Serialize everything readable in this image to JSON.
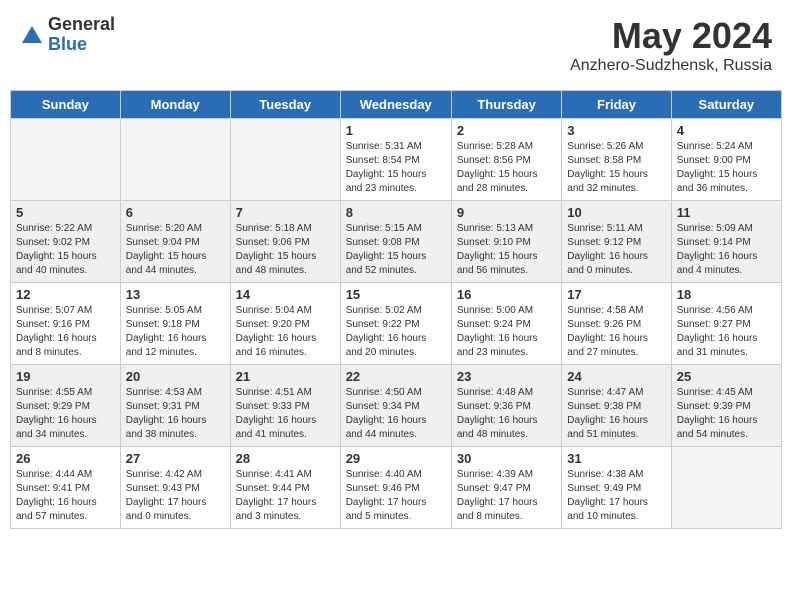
{
  "header": {
    "logo_general": "General",
    "logo_blue": "Blue",
    "month_year": "May 2024",
    "location": "Anzhero-Sudzhensk, Russia"
  },
  "days_of_week": [
    "Sunday",
    "Monday",
    "Tuesday",
    "Wednesday",
    "Thursday",
    "Friday",
    "Saturday"
  ],
  "weeks": [
    [
      {
        "day": "",
        "info": ""
      },
      {
        "day": "",
        "info": ""
      },
      {
        "day": "",
        "info": ""
      },
      {
        "day": "1",
        "info": "Sunrise: 5:31 AM\nSunset: 8:54 PM\nDaylight: 15 hours\nand 23 minutes."
      },
      {
        "day": "2",
        "info": "Sunrise: 5:28 AM\nSunset: 8:56 PM\nDaylight: 15 hours\nand 28 minutes."
      },
      {
        "day": "3",
        "info": "Sunrise: 5:26 AM\nSunset: 8:58 PM\nDaylight: 15 hours\nand 32 minutes."
      },
      {
        "day": "4",
        "info": "Sunrise: 5:24 AM\nSunset: 9:00 PM\nDaylight: 15 hours\nand 36 minutes."
      }
    ],
    [
      {
        "day": "5",
        "info": "Sunrise: 5:22 AM\nSunset: 9:02 PM\nDaylight: 15 hours\nand 40 minutes."
      },
      {
        "day": "6",
        "info": "Sunrise: 5:20 AM\nSunset: 9:04 PM\nDaylight: 15 hours\nand 44 minutes."
      },
      {
        "day": "7",
        "info": "Sunrise: 5:18 AM\nSunset: 9:06 PM\nDaylight: 15 hours\nand 48 minutes."
      },
      {
        "day": "8",
        "info": "Sunrise: 5:15 AM\nSunset: 9:08 PM\nDaylight: 15 hours\nand 52 minutes."
      },
      {
        "day": "9",
        "info": "Sunrise: 5:13 AM\nSunset: 9:10 PM\nDaylight: 15 hours\nand 56 minutes."
      },
      {
        "day": "10",
        "info": "Sunrise: 5:11 AM\nSunset: 9:12 PM\nDaylight: 16 hours\nand 0 minutes."
      },
      {
        "day": "11",
        "info": "Sunrise: 5:09 AM\nSunset: 9:14 PM\nDaylight: 16 hours\nand 4 minutes."
      }
    ],
    [
      {
        "day": "12",
        "info": "Sunrise: 5:07 AM\nSunset: 9:16 PM\nDaylight: 16 hours\nand 8 minutes."
      },
      {
        "day": "13",
        "info": "Sunrise: 5:05 AM\nSunset: 9:18 PM\nDaylight: 16 hours\nand 12 minutes."
      },
      {
        "day": "14",
        "info": "Sunrise: 5:04 AM\nSunset: 9:20 PM\nDaylight: 16 hours\nand 16 minutes."
      },
      {
        "day": "15",
        "info": "Sunrise: 5:02 AM\nSunset: 9:22 PM\nDaylight: 16 hours\nand 20 minutes."
      },
      {
        "day": "16",
        "info": "Sunrise: 5:00 AM\nSunset: 9:24 PM\nDaylight: 16 hours\nand 23 minutes."
      },
      {
        "day": "17",
        "info": "Sunrise: 4:58 AM\nSunset: 9:26 PM\nDaylight: 16 hours\nand 27 minutes."
      },
      {
        "day": "18",
        "info": "Sunrise: 4:56 AM\nSunset: 9:27 PM\nDaylight: 16 hours\nand 31 minutes."
      }
    ],
    [
      {
        "day": "19",
        "info": "Sunrise: 4:55 AM\nSunset: 9:29 PM\nDaylight: 16 hours\nand 34 minutes."
      },
      {
        "day": "20",
        "info": "Sunrise: 4:53 AM\nSunset: 9:31 PM\nDaylight: 16 hours\nand 38 minutes."
      },
      {
        "day": "21",
        "info": "Sunrise: 4:51 AM\nSunset: 9:33 PM\nDaylight: 16 hours\nand 41 minutes."
      },
      {
        "day": "22",
        "info": "Sunrise: 4:50 AM\nSunset: 9:34 PM\nDaylight: 16 hours\nand 44 minutes."
      },
      {
        "day": "23",
        "info": "Sunrise: 4:48 AM\nSunset: 9:36 PM\nDaylight: 16 hours\nand 48 minutes."
      },
      {
        "day": "24",
        "info": "Sunrise: 4:47 AM\nSunset: 9:38 PM\nDaylight: 16 hours\nand 51 minutes."
      },
      {
        "day": "25",
        "info": "Sunrise: 4:45 AM\nSunset: 9:39 PM\nDaylight: 16 hours\nand 54 minutes."
      }
    ],
    [
      {
        "day": "26",
        "info": "Sunrise: 4:44 AM\nSunset: 9:41 PM\nDaylight: 16 hours\nand 57 minutes."
      },
      {
        "day": "27",
        "info": "Sunrise: 4:42 AM\nSunset: 9:43 PM\nDaylight: 17 hours\nand 0 minutes."
      },
      {
        "day": "28",
        "info": "Sunrise: 4:41 AM\nSunset: 9:44 PM\nDaylight: 17 hours\nand 3 minutes."
      },
      {
        "day": "29",
        "info": "Sunrise: 4:40 AM\nSunset: 9:46 PM\nDaylight: 17 hours\nand 5 minutes."
      },
      {
        "day": "30",
        "info": "Sunrise: 4:39 AM\nSunset: 9:47 PM\nDaylight: 17 hours\nand 8 minutes."
      },
      {
        "day": "31",
        "info": "Sunrise: 4:38 AM\nSunset: 9:49 PM\nDaylight: 17 hours\nand 10 minutes."
      },
      {
        "day": "",
        "info": ""
      }
    ]
  ]
}
